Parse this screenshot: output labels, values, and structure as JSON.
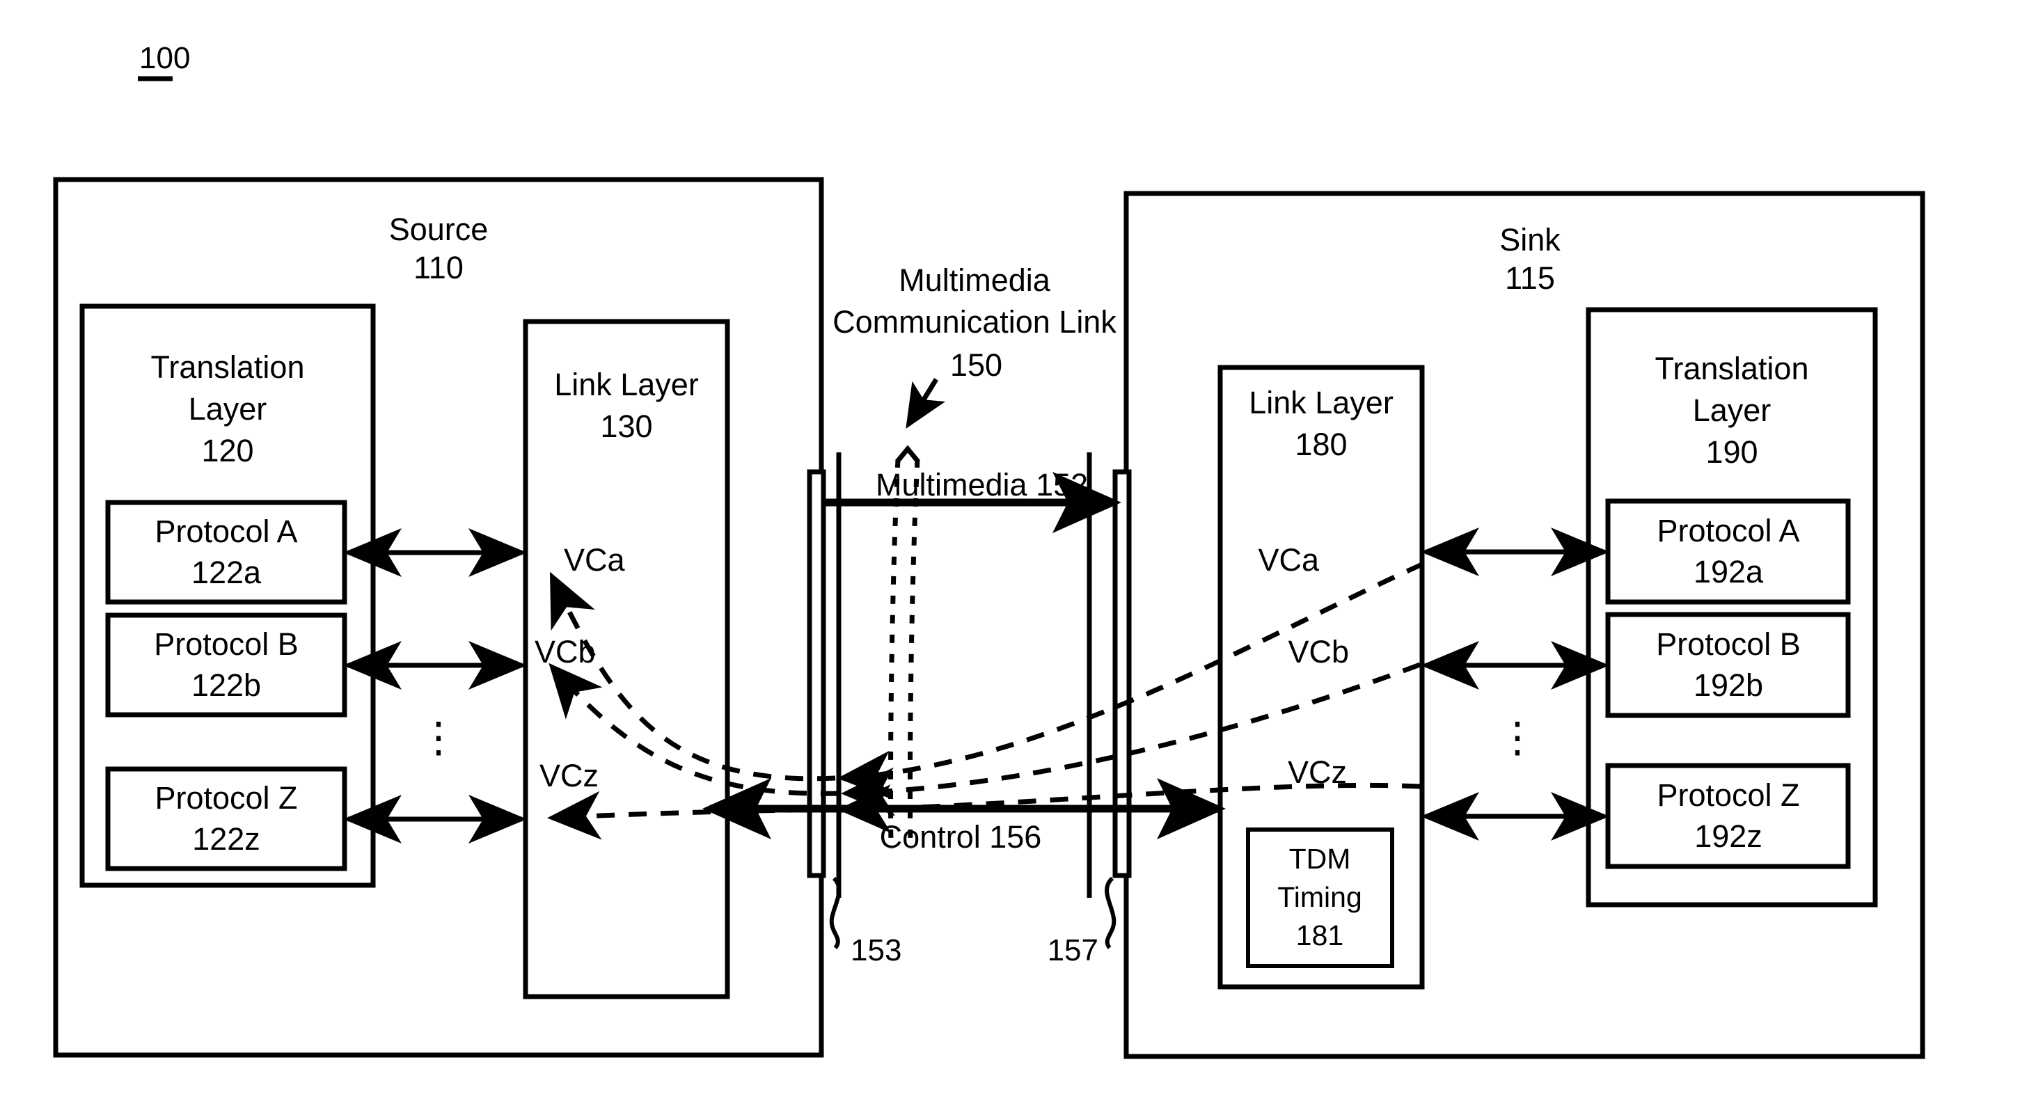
{
  "figure": {
    "number": "100"
  },
  "source": {
    "title": "Source",
    "ref": "110",
    "translation_layer": {
      "title_line1": "Translation",
      "title_line2": "Layer",
      "ref": "120",
      "protocols": [
        {
          "name": "Protocol A",
          "ref": "122a"
        },
        {
          "name": "Protocol B",
          "ref": "122b"
        },
        {
          "name": "Protocol Z",
          "ref": "122z"
        }
      ],
      "ellipsis": "⋮"
    },
    "link_layer": {
      "title": "Link Layer",
      "ref": "130",
      "virtual_channels": [
        "VCa",
        "VCb",
        "VCz"
      ]
    }
  },
  "link": {
    "title_line1": "Multimedia",
    "title_line2": "Communication Link",
    "ref": "150",
    "streams": [
      {
        "label": "Multimedia 152"
      },
      {
        "label": "Control 156"
      }
    ],
    "connector_left_ref": "153",
    "connector_right_ref": "157"
  },
  "sink": {
    "title": "Sink",
    "ref": "115",
    "link_layer": {
      "title": "Link Layer",
      "ref": "180",
      "virtual_channels": [
        "VCa",
        "VCb",
        "VCz"
      ],
      "tdm": {
        "title_line1": "TDM",
        "title_line2": "Timing",
        "ref": "181"
      }
    },
    "translation_layer": {
      "title_line1": "Translation",
      "title_line2": "Layer",
      "ref": "190",
      "protocols": [
        {
          "name": "Protocol A",
          "ref": "192a"
        },
        {
          "name": "Protocol B",
          "ref": "192b"
        },
        {
          "name": "Protocol Z",
          "ref": "192z"
        }
      ],
      "ellipsis": "⋮"
    }
  },
  "colors": {
    "ink": "#000000",
    "paper": "#ffffff"
  }
}
